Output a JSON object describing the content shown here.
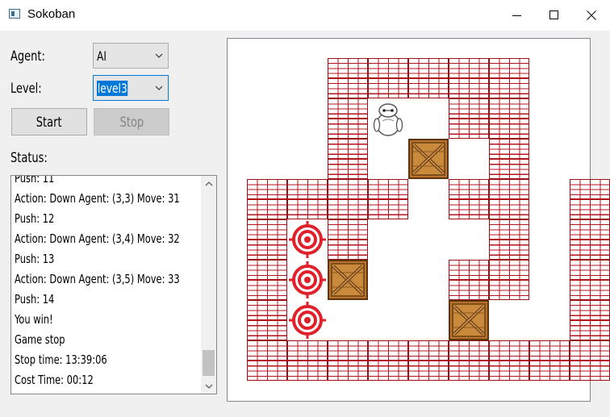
{
  "window": {
    "title": "Sokoban",
    "icons": [
      "app-icon",
      "minimize-icon",
      "maximize-icon",
      "close-icon"
    ]
  },
  "controls": {
    "agent_label": "Agent:",
    "agent_value": "AI",
    "level_label": "Level:",
    "level_value": "level3",
    "start_label": "Start",
    "stop_label": "Stop",
    "status_label": "Status:"
  },
  "status_lines": [
    "Push: 11",
    "Action: Down Agent: (3,3)  Move: 31",
    "Push: 12",
    "Action: Down Agent: (3,4)  Move: 32",
    "Push: 13",
    "Action: Down Agent: (3,5)  Move: 33",
    "Push: 14",
    "You win!",
    "Game stop",
    "Stop time:  13:39:06",
    "Cost Time: 00:12"
  ],
  "board": {
    "grid": [
      "  #####  ",
      "  #A ##  ",
      "  # B #  ",
      "#### ## #",
      "#T#   # #",
      "#TB  ## #",
      "#T   B  #",
      "#########"
    ],
    "legend": {
      "#": "wall",
      "A": "agent",
      "B": "box",
      "T": "target",
      " ": "floor"
    },
    "colors": {
      "brick": "#b3141c",
      "box": "#b8742a",
      "target": "#e0202a"
    }
  }
}
